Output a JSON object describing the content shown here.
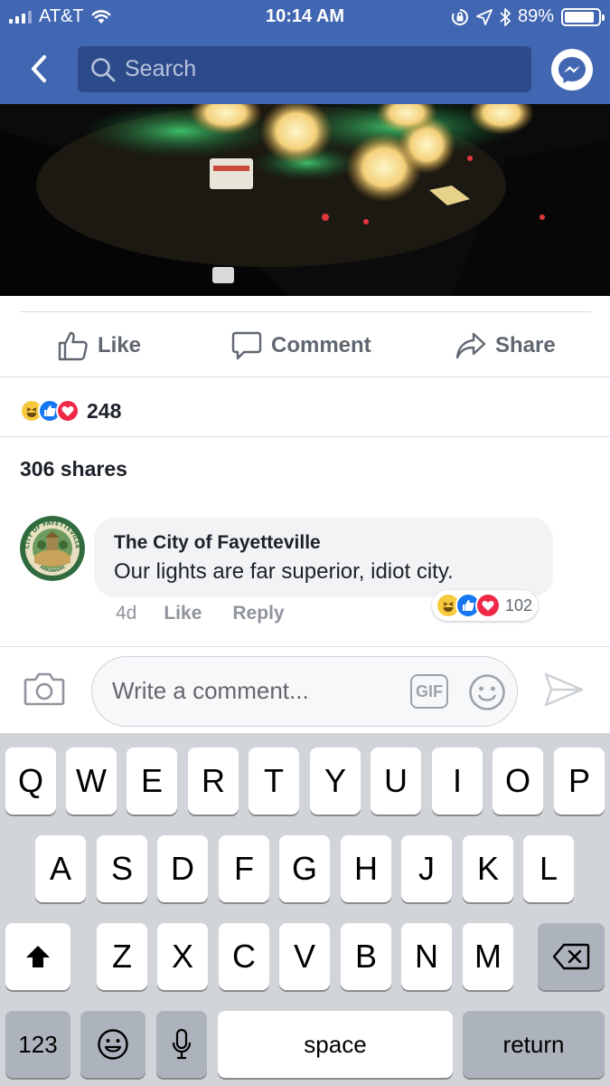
{
  "status_bar": {
    "carrier": "AT&T",
    "time": "10:14 AM",
    "battery": "89%",
    "battery_level": 0.89
  },
  "nav": {
    "search_placeholder": "Search"
  },
  "actions": {
    "like": "Like",
    "comment": "Comment",
    "share": "Share"
  },
  "reactions": {
    "types": [
      "haha",
      "like",
      "love"
    ],
    "count": "248"
  },
  "shares": "306 shares",
  "comment": {
    "avatar_text": "CITY OF FAYETTEVILLE",
    "avatar_subtext": "ARKANSAS",
    "author": "The City of Fayetteville",
    "text": "Our lights are far superior, idiot city.",
    "time": "4d",
    "like_label": "Like",
    "reply_label": "Reply",
    "reaction_types": [
      "haha",
      "like",
      "love"
    ],
    "reaction_count": "102"
  },
  "composer": {
    "placeholder": "Write a comment...",
    "gif_label": "GIF"
  },
  "keyboard": {
    "row1": [
      "Q",
      "W",
      "E",
      "R",
      "T",
      "Y",
      "U",
      "I",
      "O",
      "P"
    ],
    "row2": [
      "A",
      "S",
      "D",
      "F",
      "G",
      "H",
      "J",
      "K",
      "L"
    ],
    "row3": [
      "Z",
      "X",
      "C",
      "V",
      "B",
      "N",
      "M"
    ],
    "numbers_label": "123",
    "space_label": "space",
    "return_label": "return"
  },
  "colors": {
    "brand": "#4267b2",
    "like_blue": "#1877f2",
    "love_red": "#f0284a",
    "haha_yellow": "#f7c93e",
    "text_gray": "#606770"
  }
}
